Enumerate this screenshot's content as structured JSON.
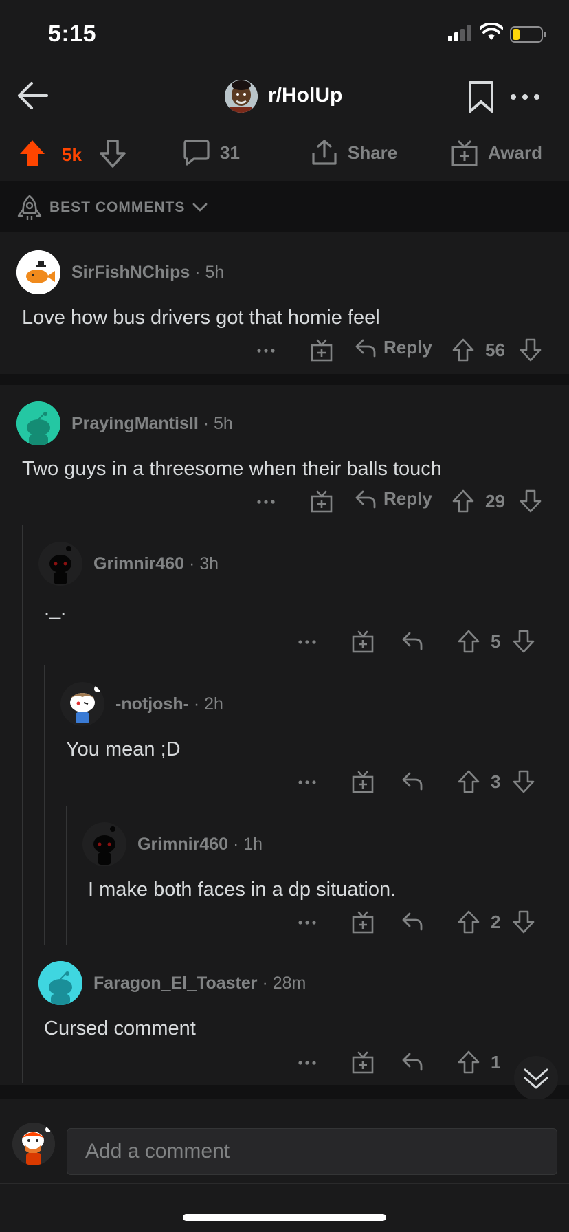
{
  "status_bar": {
    "time": "5:15"
  },
  "header": {
    "subreddit": "r/HolUp"
  },
  "post_actions": {
    "score": "5k",
    "comments": "31",
    "share": "Share",
    "award": "Award"
  },
  "sort": {
    "label": "BEST COMMENTS"
  },
  "comments": [
    {
      "user": "SirFishNChips",
      "age": "5h",
      "body": "Love how bus drivers got that homie feel",
      "reply": "Reply",
      "score": "56"
    },
    {
      "user": "PrayingMantisII",
      "age": "5h",
      "body": "Two guys in a threesome when their balls touch",
      "reply": "Reply",
      "score": "29"
    },
    {
      "user": "Grimnir460",
      "age": "3h",
      "body": "._.",
      "score": "5"
    },
    {
      "user": "-notjosh-",
      "age": "2h",
      "body": "You mean ;D",
      "score": "3"
    },
    {
      "user": "Grimnir460",
      "age": "1h",
      "body": "I make both faces in a dp situation.",
      "score": "2"
    },
    {
      "user": "Faragon_El_Toaster",
      "age": "28m",
      "body": "Cursed comment",
      "score": "1"
    }
  ],
  "composer": {
    "placeholder": "Add a comment"
  },
  "colors": {
    "accent": "#ff4500",
    "background": "#1a1a1b",
    "muted": "#818384",
    "text": "#d7dadc"
  },
  "icons": [
    "back-arrow-icon",
    "bookmark-icon",
    "more-icon",
    "upvote-icon",
    "downvote-icon",
    "comment-icon",
    "share-icon",
    "award-icon",
    "rocket-icon",
    "chevron-down-icon",
    "reply-icon",
    "gift-icon",
    "scroll-down-icon"
  ]
}
